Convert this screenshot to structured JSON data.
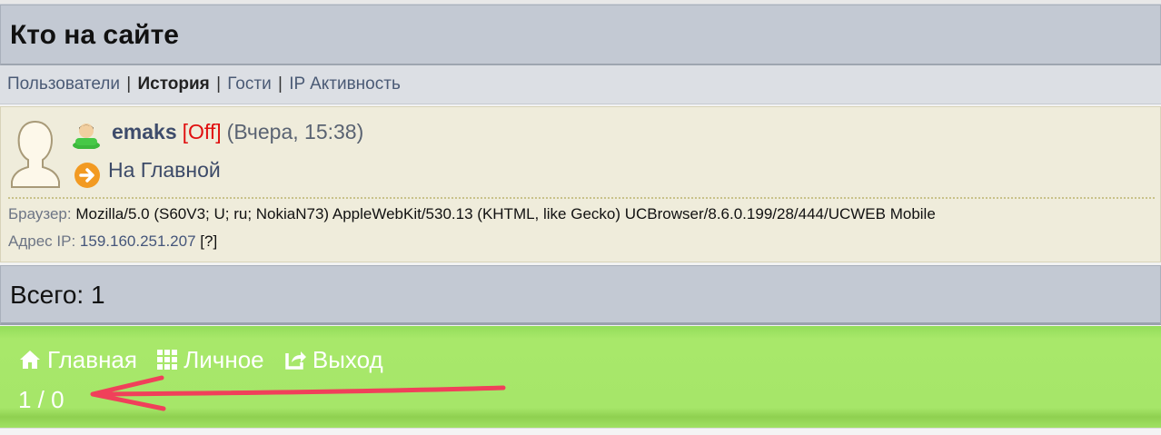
{
  "page": {
    "title": "Кто на сайте"
  },
  "nav": {
    "items": [
      "Пользователи",
      "История",
      "Гости",
      "IP Активность"
    ],
    "separator": "|"
  },
  "entry": {
    "nick": "emaks",
    "status": "[Off]",
    "time": "(Вчера, 15:38)",
    "location": "На Главной",
    "browser_label": "Браузер:",
    "browser_value": "Mozilla/5.0 (S60V3; U; ru; NokiaN73) AppleWebKit/530.13 (KHTML, like Gecko) UCBrowser/8.6.0.199/28/444/UCWEB Mobile",
    "ip_label": "Адрес IP:",
    "ip_value": "159.160.251.207",
    "ip_help": "[?]"
  },
  "total": {
    "label": "Всего: 1"
  },
  "footer": {
    "home": "Главная",
    "personal": "Личное",
    "logout": "Выход",
    "counter": "1 / 0"
  },
  "colors": {
    "header_bg": "#c3c9d3",
    "entry_bg": "#efecdb",
    "footer_green": "#a8e86a",
    "status_off": "#e01010",
    "annotation_arrow": "#f0405a"
  },
  "icons": [
    "avatar-silhouette-icon",
    "user-online-icon",
    "orange-arrow-icon",
    "home-icon",
    "grid-icon",
    "logout-icon"
  ]
}
